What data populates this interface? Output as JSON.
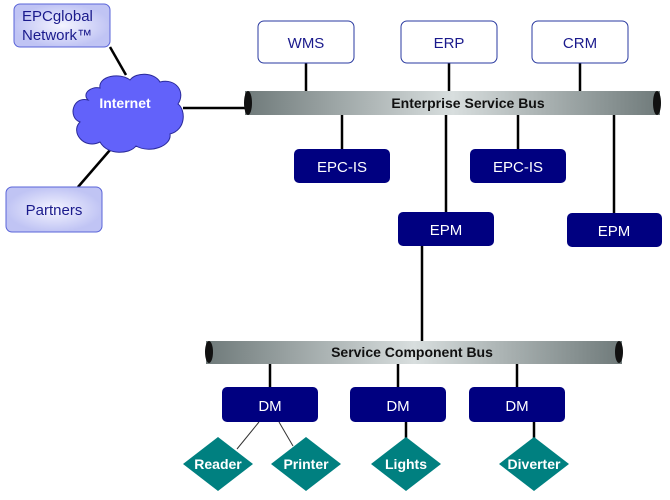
{
  "external": {
    "epcglobal": [
      "EPCglobal",
      "Network™"
    ],
    "partners": "Partners",
    "internet": "Internet"
  },
  "apps": [
    "WMS",
    "ERP",
    "CRM"
  ],
  "esb": "Enterprise Service Bus",
  "epcis": [
    "EPC-IS",
    "EPC-IS"
  ],
  "epm": [
    "EPM",
    "EPM"
  ],
  "scb": "Service Component Bus",
  "dm": [
    "DM",
    "DM",
    "DM"
  ],
  "devices": [
    "Reader",
    "Printer",
    "Lights",
    "Diverter"
  ],
  "colors": {
    "dark_box": "#000080",
    "light_box": "#c8ccf8",
    "cloud": "#6262fa",
    "device": "#008080",
    "bus": "#8f9a9a"
  }
}
